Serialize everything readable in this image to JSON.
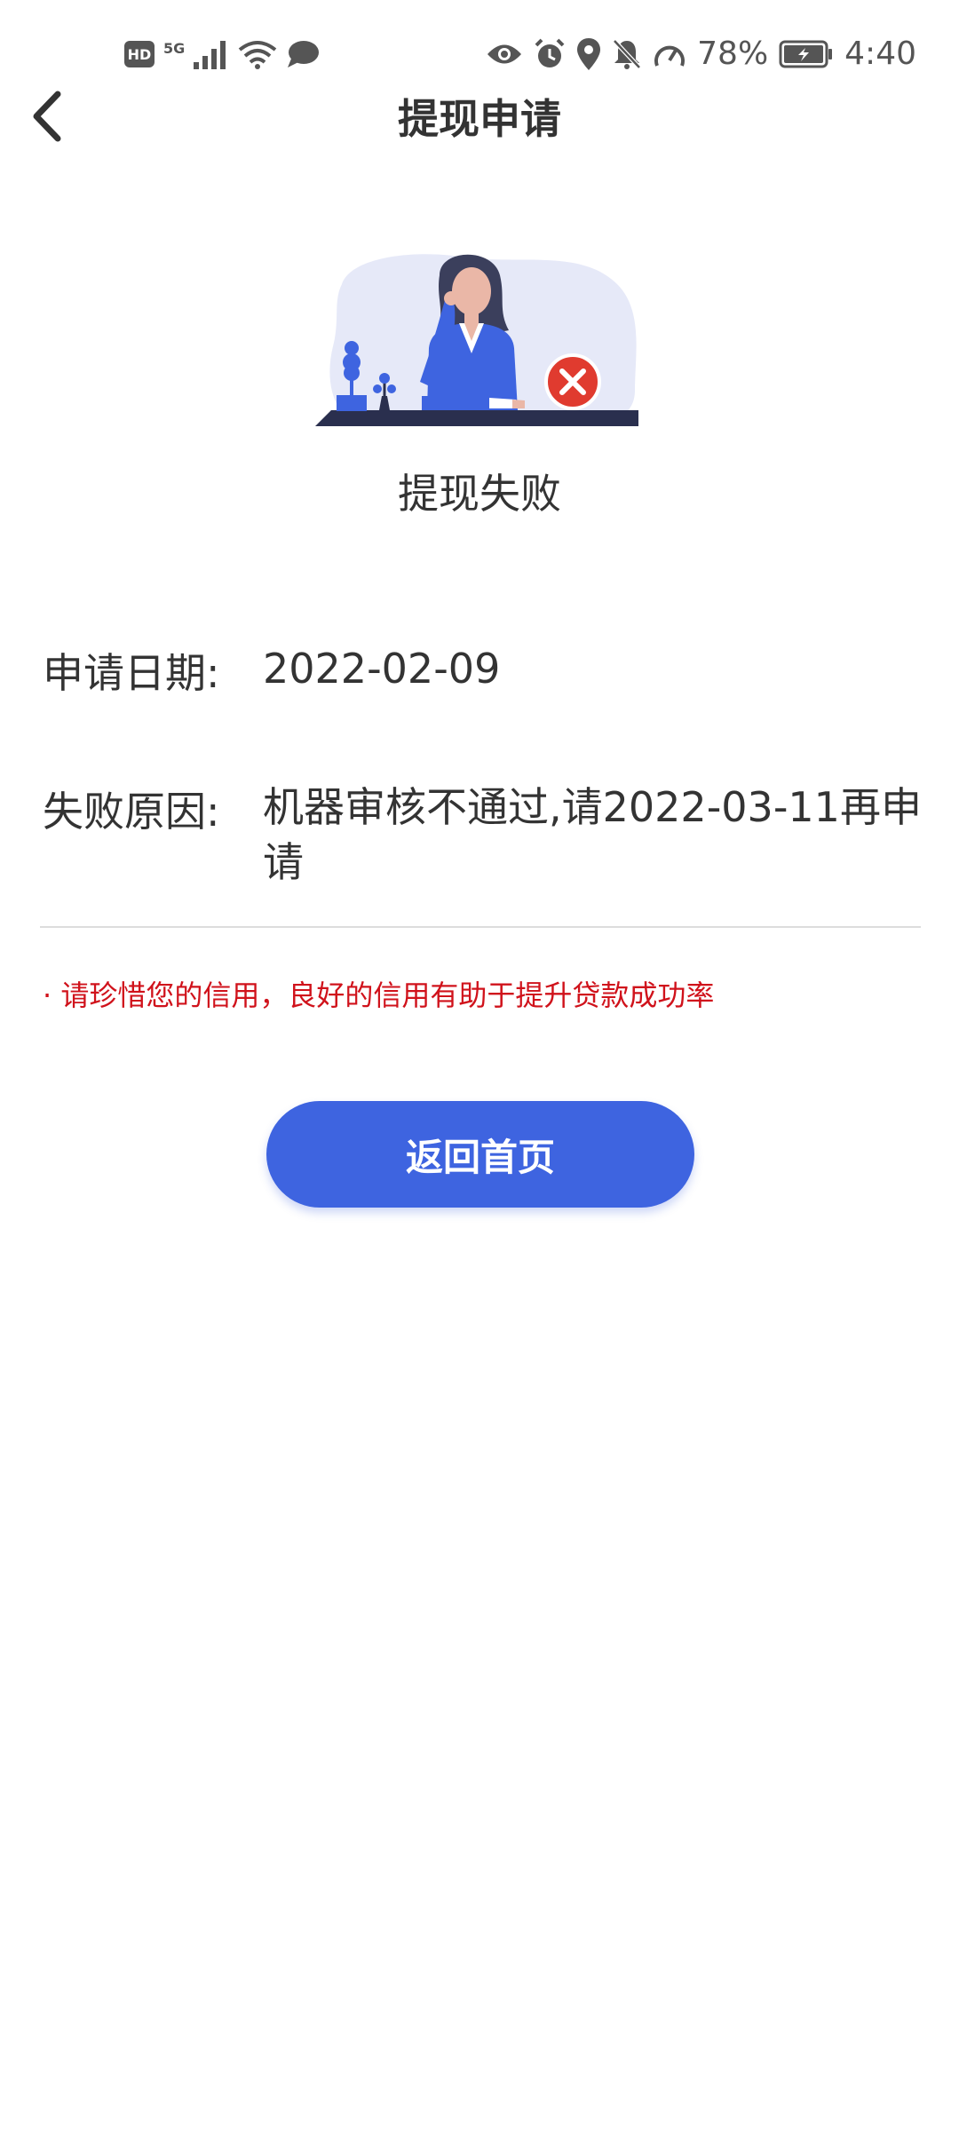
{
  "status_bar": {
    "hd": "HD",
    "network": "5G",
    "battery_percent": "78%",
    "time": "4:40",
    "icons": [
      "hd-icon",
      "signal-icon",
      "wifi-icon",
      "message-icon",
      "eye-icon",
      "alarm-icon",
      "location-icon",
      "mute-icon",
      "speed-icon",
      "battery-icon"
    ]
  },
  "header": {
    "title": "提现申请",
    "back_icon": "chevron-left-icon"
  },
  "result": {
    "title": "提现失败",
    "status_icon": "error-x-icon"
  },
  "info": {
    "date_label": "申请日期:",
    "date_value": "2022-02-09",
    "reason_label": "失败原因:",
    "reason_value": "机器审核不通过,请2022-03-11再申请"
  },
  "notice": "· 请珍惜您的信用，良好的信用有助于提升贷款成功率",
  "actions": {
    "home_label": "返回首页"
  },
  "colors": {
    "accent": "#3e64e0",
    "warning_text": "#d0121b",
    "error_badge": "#e03b2f"
  }
}
